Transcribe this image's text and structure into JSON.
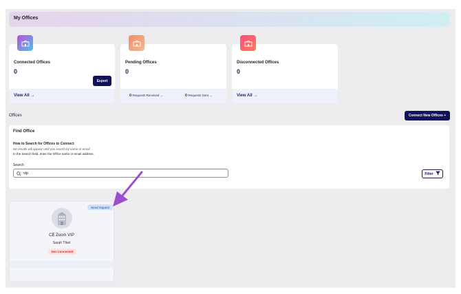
{
  "page": {
    "title": "My Offices"
  },
  "stats": {
    "connected": {
      "title": "Connected Offices",
      "count": "0",
      "view_all": "View All",
      "export_label": "Export"
    },
    "pending": {
      "title": "Pending Offices",
      "count": "0",
      "received_count": "0",
      "received_label": "Requests Received",
      "sent_count": "0",
      "sent_label": "Requests Sent"
    },
    "disconnected": {
      "title": "Disconnected Offices",
      "count": "0",
      "view_all": "View All"
    }
  },
  "offices": {
    "label": "Offices",
    "connect_button": "Connect New Offices +"
  },
  "find": {
    "title": "Find Office",
    "how_title": "How to Search for Offices to Connect",
    "hint": "No results will appear until you search by name or email",
    "instructions": "In the Search field, enter the Office name or email address.",
    "search_label": "Search",
    "search_value": "vip",
    "filter_label": "Filter"
  },
  "results": [
    {
      "badge": "Send request",
      "name": "CE Zoom VIP",
      "owner": "Sarah Thiel",
      "status": "Not Connected"
    }
  ],
  "colors": {
    "accent": "#12125a",
    "connected_icon": [
      "#b84fd6",
      "#4fc3e8"
    ],
    "pending_icon": [
      "#f28c6c",
      "#f4b98c"
    ],
    "disconnected_icon": [
      "#ff4e7a",
      "#ff7a59"
    ],
    "annotation_arrow": "#9b4fd0"
  },
  "icons": {
    "stat": "office-building-icon",
    "search": "search-icon",
    "filter": "funnel-icon",
    "avatar": "building-icon",
    "arrow": "right-arrow-icon"
  }
}
